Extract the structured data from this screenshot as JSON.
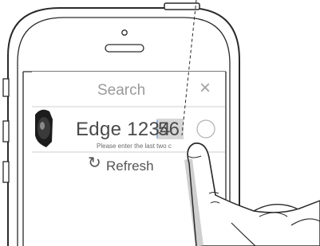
{
  "dialog": {
    "title": "Search",
    "close_glyph": "×"
  },
  "device": {
    "name_prefix": "Edge 1234",
    "name_suffix": "56",
    "hint": "Please enter the last two c",
    "icon": "fitness-band-icon",
    "selector_icon": "radio-circle-icon"
  },
  "refresh": {
    "label": "Refresh",
    "icon": "refresh-icon"
  },
  "colors": {
    "highlight": "#d6d6d6",
    "line": "#2a2a2a",
    "divider": "#cfcfcf"
  }
}
